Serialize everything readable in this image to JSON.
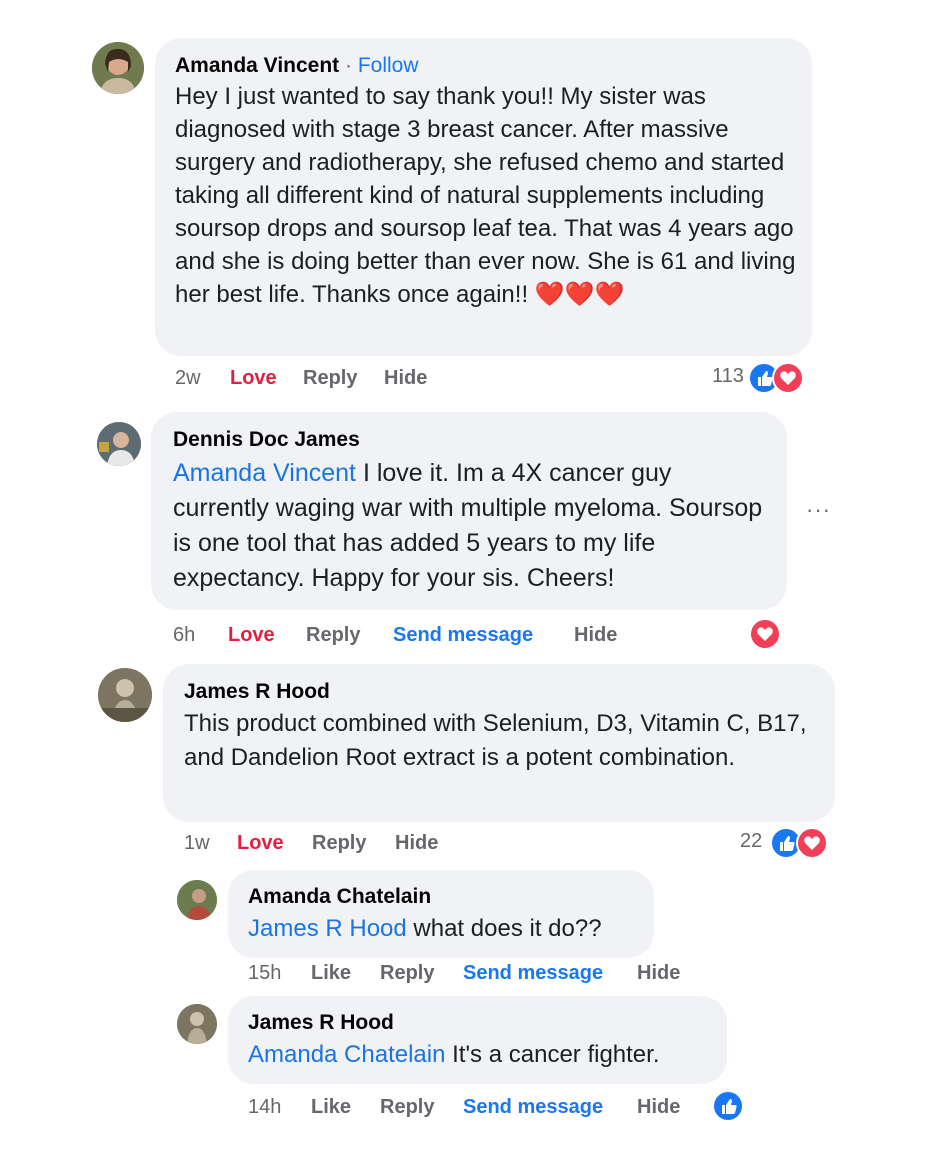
{
  "comments": [
    {
      "author": "Amanda Vincent",
      "follow_sep": "·",
      "follow": "Follow",
      "text": "Hey I just wanted to say thank you!! My sister was diagnosed with stage 3 breast cancer. After massive surgery and radiotherapy, she refused chemo and started taking all different kind of natural supplements including soursop drops and soursop leaf tea. That was 4 years ago and she is doing better than ever now. She is 61 and living her best life. Thanks once again!!",
      "emoji": "❤️❤️❤️",
      "time": "2w",
      "love": "Love",
      "reply": "Reply",
      "hide": "Hide",
      "reaction_count": "113"
    },
    {
      "author": "Dennis Doc James",
      "mention": "Amanda Vincent",
      "text": "I love it. Im a 4X cancer guy currently waging war with multiple myeloma. Soursop is one tool that has added 5 years to my life expectancy. Happy for your sis. Cheers!",
      "time": "6h",
      "love": "Love",
      "reply": "Reply",
      "send_message": "Send message",
      "hide": "Hide",
      "more": "···"
    },
    {
      "author": "James R Hood",
      "text": "This product combined with Selenium, D3, Vitamin C, B17, and Dandelion Root extract is a potent combination.",
      "time": "1w",
      "love": "Love",
      "reply": "Reply",
      "hide": "Hide",
      "reaction_count": "22"
    },
    {
      "author": "Amanda Chatelain",
      "mention": "James R Hood",
      "text": "what does it do??",
      "time": "15h",
      "like": "Like",
      "reply": "Reply",
      "send_message": "Send message",
      "hide": "Hide"
    },
    {
      "author": "James R Hood",
      "mention": "Amanda Chatelain",
      "text": "It's a cancer fighter.",
      "time": "14h",
      "like": "Like",
      "reply": "Reply",
      "send_message": "Send message",
      "hide": "Hide"
    }
  ],
  "icons": {
    "like": "like-icon",
    "heart": "heart-icon",
    "more": "more-options-icon"
  },
  "colors": {
    "bubble": "#f0f2f5",
    "link": "#1877f2",
    "love": "#e41e3f",
    "meta": "#65676b"
  }
}
